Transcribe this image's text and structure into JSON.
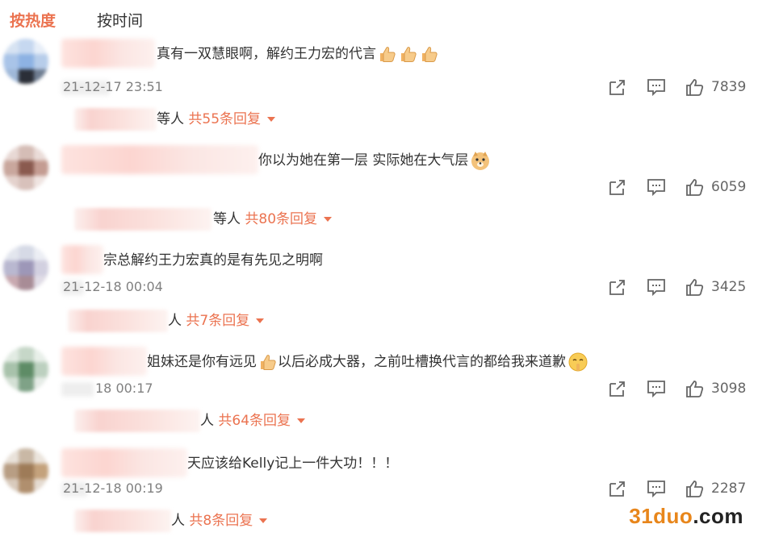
{
  "tabs": [
    {
      "label": "按热度",
      "active": true
    },
    {
      "label": "按时间",
      "active": false
    }
  ],
  "comments": [
    {
      "text": "真有一双慧眼啊，解约王力宏的代言",
      "emoji": [
        "thumbs-up",
        "thumbs-up",
        "thumbs-up"
      ],
      "time": "21-12-17 23:51",
      "likes": "7839",
      "reply_who": "等人",
      "reply_link": "共55条回复"
    },
    {
      "text": "你以为她在第一层 实际她在大气层",
      "emoji": [
        "doge"
      ],
      "time": "",
      "likes": "6059",
      "reply_who": "等人",
      "reply_link": "共80条回复"
    },
    {
      "text": "宗总解约王力宏真的是有先见之明啊",
      "emoji": [],
      "time": "21-12-18 00:04",
      "likes": "3425",
      "reply_who": "人",
      "reply_link": "共7条回复"
    },
    {
      "text_a": "姐妹还是你有远见",
      "text_b": "以后必成大器，之前吐槽换代言的都给我来道歉",
      "emoji": [
        "thumbs-up",
        "shush"
      ],
      "time": "18 00:17",
      "likes": "3098",
      "reply_who": "人",
      "reply_link": "共64条回复"
    },
    {
      "text": "天应该给Kelly记上一件大功！！！",
      "emoji": [],
      "time": "21-12-18 00:19",
      "likes": "2287",
      "reply_who": "人",
      "reply_link": "共8条回复"
    }
  ],
  "icons": {
    "share": "share-icon",
    "comment": "comment-icon",
    "like": "like-icon"
  },
  "colors": {
    "accent": "#eb7350",
    "text": "#333333",
    "muted": "#808080"
  },
  "watermark": {
    "part_a": "31duo",
    "part_b": ".com"
  }
}
